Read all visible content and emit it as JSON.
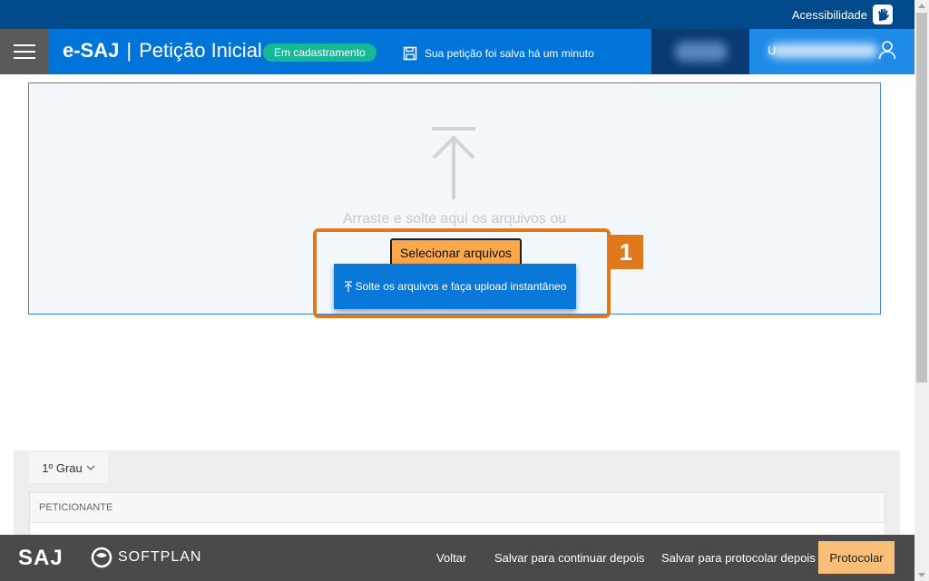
{
  "topbar": {
    "accessibility_label": "Acessibilidade"
  },
  "header": {
    "brand": "e-SAJ",
    "title": "Petição Inicial",
    "status_badge": "Em cadastramento",
    "saved_message": "Sua petição foi salva há um minuto",
    "user_initial": "U"
  },
  "dropzone": {
    "instruction": "Arraste e solte aqui os arquivos ou",
    "select_button": "Selecionar arquivos",
    "upload_button": "Solte os arquivos e faça upload instantâneo"
  },
  "annotation": {
    "number": "1",
    "color": "#e0791b"
  },
  "panel": {
    "grau_select": "1º Grau",
    "peticionante_header": "PETICIONANTE"
  },
  "footer": {
    "logo_saj": "SAJ",
    "logo_softplan": "SOFTPLAN",
    "links": [
      "Voltar",
      "Salvar para continuar depois",
      "Salvar para protocolar depois"
    ],
    "primary_button": "Protocolar"
  },
  "colors": {
    "top_bar": "#004a8c",
    "header": "#0074d9",
    "badge": "#17b897",
    "select_button": "#f9a84a",
    "upload_button": "#0a78d8",
    "protocolar_button": "#f9be78",
    "footer": "#4a4a4a"
  },
  "icons": [
    "hand-sign-icon",
    "hamburger-menu-icon",
    "floppy-disk-icon",
    "user-icon",
    "upload-arrow-icon",
    "chevron-down-icon",
    "softplan-logo-icon"
  ]
}
